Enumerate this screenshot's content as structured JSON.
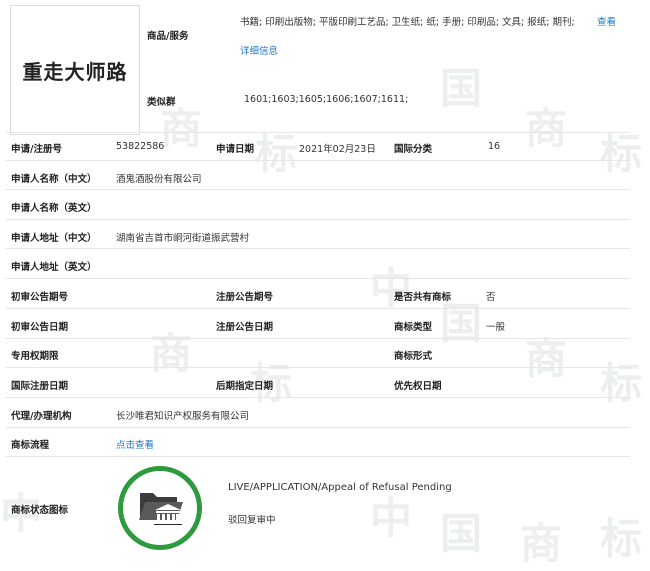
{
  "trademark": {
    "name": "重走大师路"
  },
  "goods": {
    "label": "商品/服务",
    "value": "书籍; 印刷出版物; 平版印刷工艺品; 卫生纸; 纸; 手册; 印刷品; 文具; 报纸; 期刊;",
    "view_link": "查看",
    "detail_link": "详细信息"
  },
  "similar_group": {
    "label": "类似群",
    "value": "1601;1603;1605;1606;1607;1611;"
  },
  "reg_no": {
    "label": "申请/注册号",
    "value": "53822586"
  },
  "apply_date": {
    "label": "申请日期",
    "value": "2021年02月23日"
  },
  "intl_class": {
    "label": "国际分类",
    "value": "16"
  },
  "applicant_cn": {
    "label": "申请人名称（中文）",
    "value": "酒鬼酒股份有限公司"
  },
  "applicant_en": {
    "label": "申请人名称（英文）",
    "value": ""
  },
  "address_cn": {
    "label": "申请人地址（中文）",
    "value": "湖南省吉首市峒河街道振武营村"
  },
  "address_en": {
    "label": "申请人地址（英文）",
    "value": ""
  },
  "prelim_no": {
    "label": "初审公告期号",
    "value": ""
  },
  "reg_pub_no": {
    "label": "注册公告期号",
    "value": ""
  },
  "shared": {
    "label": "是否共有商标",
    "value": "否"
  },
  "prelim_date": {
    "label": "初审公告日期",
    "value": ""
  },
  "reg_pub_date": {
    "label": "注册公告日期",
    "value": ""
  },
  "tm_type": {
    "label": "商标类型",
    "value": "一般"
  },
  "exclusive_period": {
    "label": "专用权期限",
    "value": ""
  },
  "tm_form": {
    "label": "商标形式",
    "value": ""
  },
  "intl_reg_date": {
    "label": "国际注册日期",
    "value": ""
  },
  "later_date": {
    "label": "后期指定日期",
    "value": ""
  },
  "priority_date": {
    "label": "优先权日期",
    "value": ""
  },
  "agency": {
    "label": "代理/办理机构",
    "value": "长沙唯君知识产权服务有限公司"
  },
  "process": {
    "label": "商标流程",
    "link": "点击查看"
  },
  "status": {
    "label": "商标状态图标",
    "english": "LIVE/APPLICATION/Appeal of Refusal Pending",
    "chinese": "驳回复审中",
    "icon": "folder-bank-icon",
    "ring_color": "#2e9a3e"
  },
  "watermark_chars": [
    "中",
    "国",
    "商",
    "标"
  ]
}
